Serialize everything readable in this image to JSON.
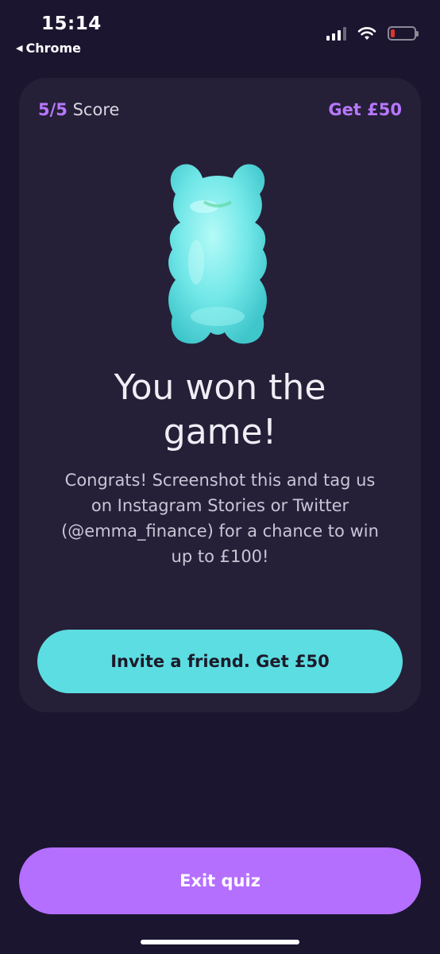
{
  "status_bar": {
    "time": "15:14",
    "back_app": "Chrome",
    "battery_color": "#e0332c"
  },
  "card": {
    "score_value": "5/5",
    "score_label": "Score",
    "reward_link": "Get £50",
    "mascot_icon": "gummy-bear-icon",
    "title": "You won the game!",
    "body": "Congrats! Screenshot this and tag us on Instagram Stories or Twitter (@emma_finance) for a chance to win up to £100!",
    "invite_button": "Invite a friend. Get £50"
  },
  "footer": {
    "exit_button": "Exit quiz"
  },
  "colors": {
    "background": "#1b1530",
    "card": "#252037",
    "accent_purple": "#b877ff",
    "accent_teal": "#5cdde1"
  }
}
